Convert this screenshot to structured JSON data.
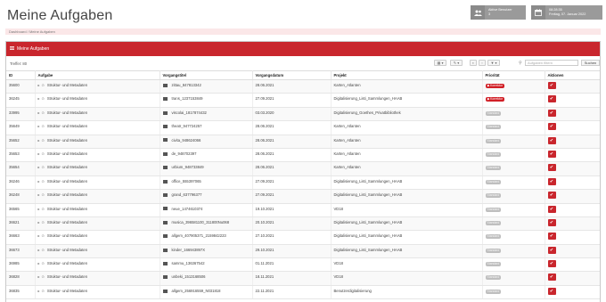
{
  "page": {
    "title": "Meine Aufgaben"
  },
  "header_boxes": {
    "users": {
      "icon": "users-icon",
      "label": "Aktive Benutzer",
      "value": "3"
    },
    "date": {
      "icon": "calendar-icon",
      "time": "08:28:35",
      "date": "Freitag, 07. Januar 2022"
    }
  },
  "breadcrumb": {
    "items": [
      "Dashboard",
      "Meine Aufgaben"
    ],
    "separator": "/"
  },
  "panel": {
    "title": "Meine Aufgaben",
    "hits": "Treffer: 80"
  },
  "toolbar": {
    "search_placeholder": "Aufgaben filtern",
    "search_button": "Suchen"
  },
  "table": {
    "headers": [
      "ID",
      "Aufgabe",
      "Vorgangstitel",
      "Vorgangsdatum",
      "Projekt",
      "Priorität",
      "Aktionen"
    ],
    "rows": [
      {
        "id": "35600",
        "task": "Struktur- und Metadaten",
        "title": "zittau_847813342",
        "date": "28.06.2021",
        "project": "Karten_Atlanten",
        "priority": "Korrektur",
        "priority_type": "red"
      },
      {
        "id": "36245",
        "task": "Struktur- und Metadaten",
        "title": "trans_1237153849",
        "date": "27.09.2021",
        "project": "Digitalisierung_Listi_Sammlungen_HAAB",
        "priority": "Korrektur",
        "priority_type": "red"
      },
      {
        "id": "33995",
        "task": "Struktur- und Metadaten",
        "title": "viscolai_1817874432",
        "date": "03.03.2020",
        "project": "Digitalisierung_Goethes_Privatbibliothek",
        "priority": "Standard",
        "priority_type": "grey"
      },
      {
        "id": "35649",
        "task": "Struktur- und Metadaten",
        "title": "theatr_947724257",
        "date": "28.06.2021",
        "project": "Karten_Atlanten",
        "priority": "Standard",
        "priority_type": "grey"
      },
      {
        "id": "35652",
        "task": "Struktur- und Metadaten",
        "title": "civita_948624066",
        "date": "28.06.2021",
        "project": "Karten_Atlanten",
        "priority": "Standard",
        "priority_type": "grey"
      },
      {
        "id": "35653",
        "task": "Struktur- und Metadaten",
        "title": "de_948702397",
        "date": "28.06.2021",
        "project": "Karten_Atlanten",
        "priority": "Standard",
        "priority_type": "grey"
      },
      {
        "id": "35654",
        "task": "Struktur- und Metadaten",
        "title": "urbium_948733849",
        "date": "28.06.2021",
        "project": "Karten_Atlanten",
        "priority": "Standard",
        "priority_type": "grey"
      },
      {
        "id": "36246",
        "task": "Struktur- und Metadaten",
        "title": "office_555397065",
        "date": "27.09.2021",
        "project": "Digitalisierung_Listi_Sammlungen_HAAB",
        "priority": "Standard",
        "priority_type": "grey"
      },
      {
        "id": "36248",
        "task": "Struktur- und Metadaten",
        "title": "grand_637796377",
        "date": "27.09.2021",
        "project": "Digitalisierung_Listi_Sammlungen_HAAB",
        "priority": "Standard",
        "priority_type": "grey"
      },
      {
        "id": "36565",
        "task": "Struktur- und Metadaten",
        "title": "neue_1474610374",
        "date": "19.10.2021",
        "project": "VD18",
        "priority": "Standard",
        "priority_type": "grey"
      },
      {
        "id": "36621",
        "task": "Struktur- und Metadaten",
        "title": "musica_396581100_311800Nu068",
        "date": "20.10.2021",
        "project": "Digitalisierung_Listi_Sammlungen_HAAB",
        "priority": "Standard",
        "priority_type": "grey"
      },
      {
        "id": "36663",
        "task": "Struktur- und Metadaten",
        "title": "allgem_407905371_2159842223",
        "date": "27.10.2021",
        "project": "Digitalisierung_Listi_Sammlungen_HAAB",
        "priority": "Standard",
        "priority_type": "grey"
      },
      {
        "id": "36673",
        "task": "Struktur- und Metadaten",
        "title": "kinder_166943897X",
        "date": "29.10.2021",
        "project": "Digitalisierung_Listi_Sammlungen_HAAB",
        "priority": "Standard",
        "priority_type": "grey"
      },
      {
        "id": "36985",
        "task": "Struktur- und Metadaten",
        "title": "sammu_136367542",
        "date": "01.11.2021",
        "project": "VD18",
        "priority": "Standard",
        "priority_type": "grey"
      },
      {
        "id": "36828",
        "task": "Struktur- und Metadaten",
        "title": "unbeki_1513168506",
        "date": "18.11.2021",
        "project": "VD18",
        "priority": "Standard",
        "priority_type": "grey"
      },
      {
        "id": "36835",
        "task": "Struktur- und Metadaten",
        "title": "allgem_256916559_N031818",
        "date": "22.11.2021",
        "project": "Benutzerdigitalisierung",
        "priority": "Standard",
        "priority_type": "grey"
      }
    ]
  }
}
